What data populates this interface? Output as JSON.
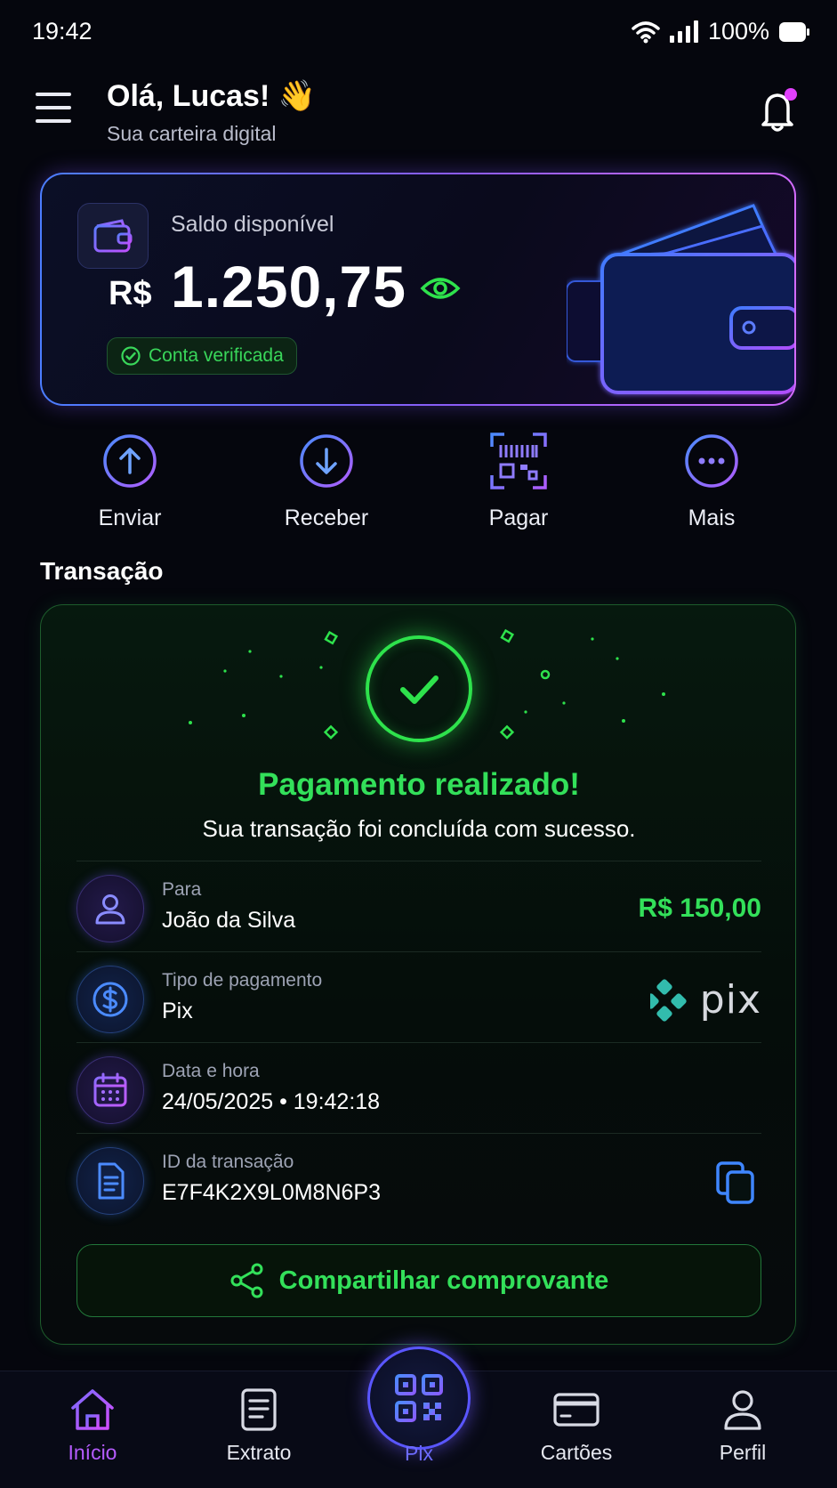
{
  "status_bar": {
    "time": "19:42",
    "battery": "100%"
  },
  "header": {
    "greeting": "Olá, Lucas! 👋",
    "subtitle": "Sua carteira digital"
  },
  "balance": {
    "label": "Saldo disponível",
    "currency": "R$",
    "amount": "1.250,75",
    "verified_label": "Conta verificada"
  },
  "actions": [
    {
      "label": "Enviar",
      "icon": "arrow-up-circle-icon"
    },
    {
      "label": "Receber",
      "icon": "arrow-down-circle-icon"
    },
    {
      "label": "Pagar",
      "icon": "qr-scan-icon"
    },
    {
      "label": "Mais",
      "icon": "more-dots-icon"
    }
  ],
  "section_title": "Transação",
  "transaction": {
    "title": "Pagamento realizado!",
    "subtitle": "Sua transação foi concluída com sucesso.",
    "to_label": "Para",
    "to_value": "João da Silva",
    "amount": "R$ 150,00",
    "type_label": "Tipo de pagamento",
    "type_value": "Pix",
    "pix_logo_text": "pix",
    "date_label": "Data e hora",
    "date_value": "24/05/2025 • 19:42:18",
    "id_label": "ID da transação",
    "id_value": "E7F4K2X9L0M8N6P3",
    "share_label": "Compartilhar comprovante"
  },
  "colors": {
    "success": "#33e05a",
    "accent": "#8b5cf6",
    "blue": "#4b7dff",
    "background": "#05060d"
  },
  "bottom_nav": [
    {
      "label": "Início",
      "icon": "home-icon",
      "active": true
    },
    {
      "label": "Extrato",
      "icon": "statement-icon",
      "active": false
    },
    {
      "label": "Pix",
      "icon": "qr-code-icon",
      "active": false
    },
    {
      "label": "Cartões",
      "icon": "card-icon",
      "active": false
    },
    {
      "label": "Perfil",
      "icon": "user-icon",
      "active": false
    }
  ]
}
